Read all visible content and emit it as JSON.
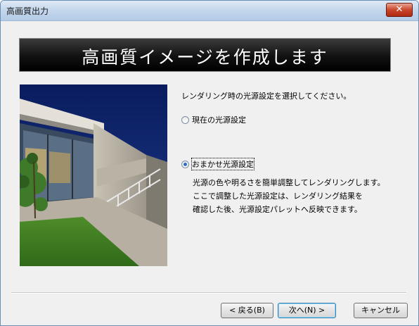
{
  "window": {
    "title": "高画質出力",
    "close_glyph": "✕"
  },
  "banner": {
    "text": "高画質イメージを作成します"
  },
  "instruction": "レンダリング時の光源設定を選択してください。",
  "options": [
    {
      "label": "現在の光源設定",
      "checked": false
    },
    {
      "label": "おまかせ光源設定",
      "checked": true
    }
  ],
  "description": [
    "光源の色や明るさを簡単調整してレンダリングします。",
    "ここで調整した光源設定は、レンダリング結果を",
    "確認した後、光源設定パレットへ反映できます。"
  ],
  "buttons": {
    "back": "< 戻る(B)",
    "next": "次へ(N) >",
    "cancel": "キャンセル"
  }
}
